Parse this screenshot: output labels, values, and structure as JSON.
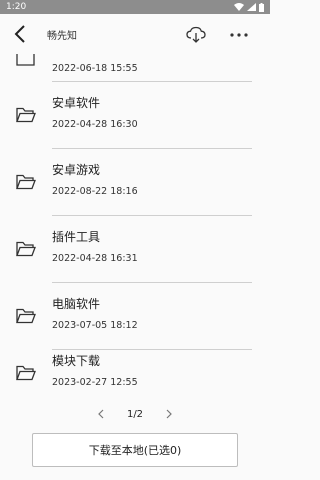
{
  "status": {
    "time": "1:20"
  },
  "header": {
    "title": "畅先知",
    "back_icon": "back-chevron-icon",
    "download_icon": "cloud-download-icon",
    "more_icon": "more-dots-icon"
  },
  "items": [
    {
      "name": "",
      "date": "2022-06-18 15:55"
    },
    {
      "name": "安卓软件",
      "date": "2022-04-28 16:30"
    },
    {
      "name": "安卓游戏",
      "date": "2022-08-22 18:16"
    },
    {
      "name": "插件工具",
      "date": "2022-04-28 16:31"
    },
    {
      "name": "电脑软件",
      "date": "2023-07-05 18:12"
    },
    {
      "name": "模块下载",
      "date": "2023-02-27 12:55"
    }
  ],
  "pager": {
    "current": "1/2"
  },
  "footer": {
    "button_label": "下载至本地(已选0)"
  }
}
